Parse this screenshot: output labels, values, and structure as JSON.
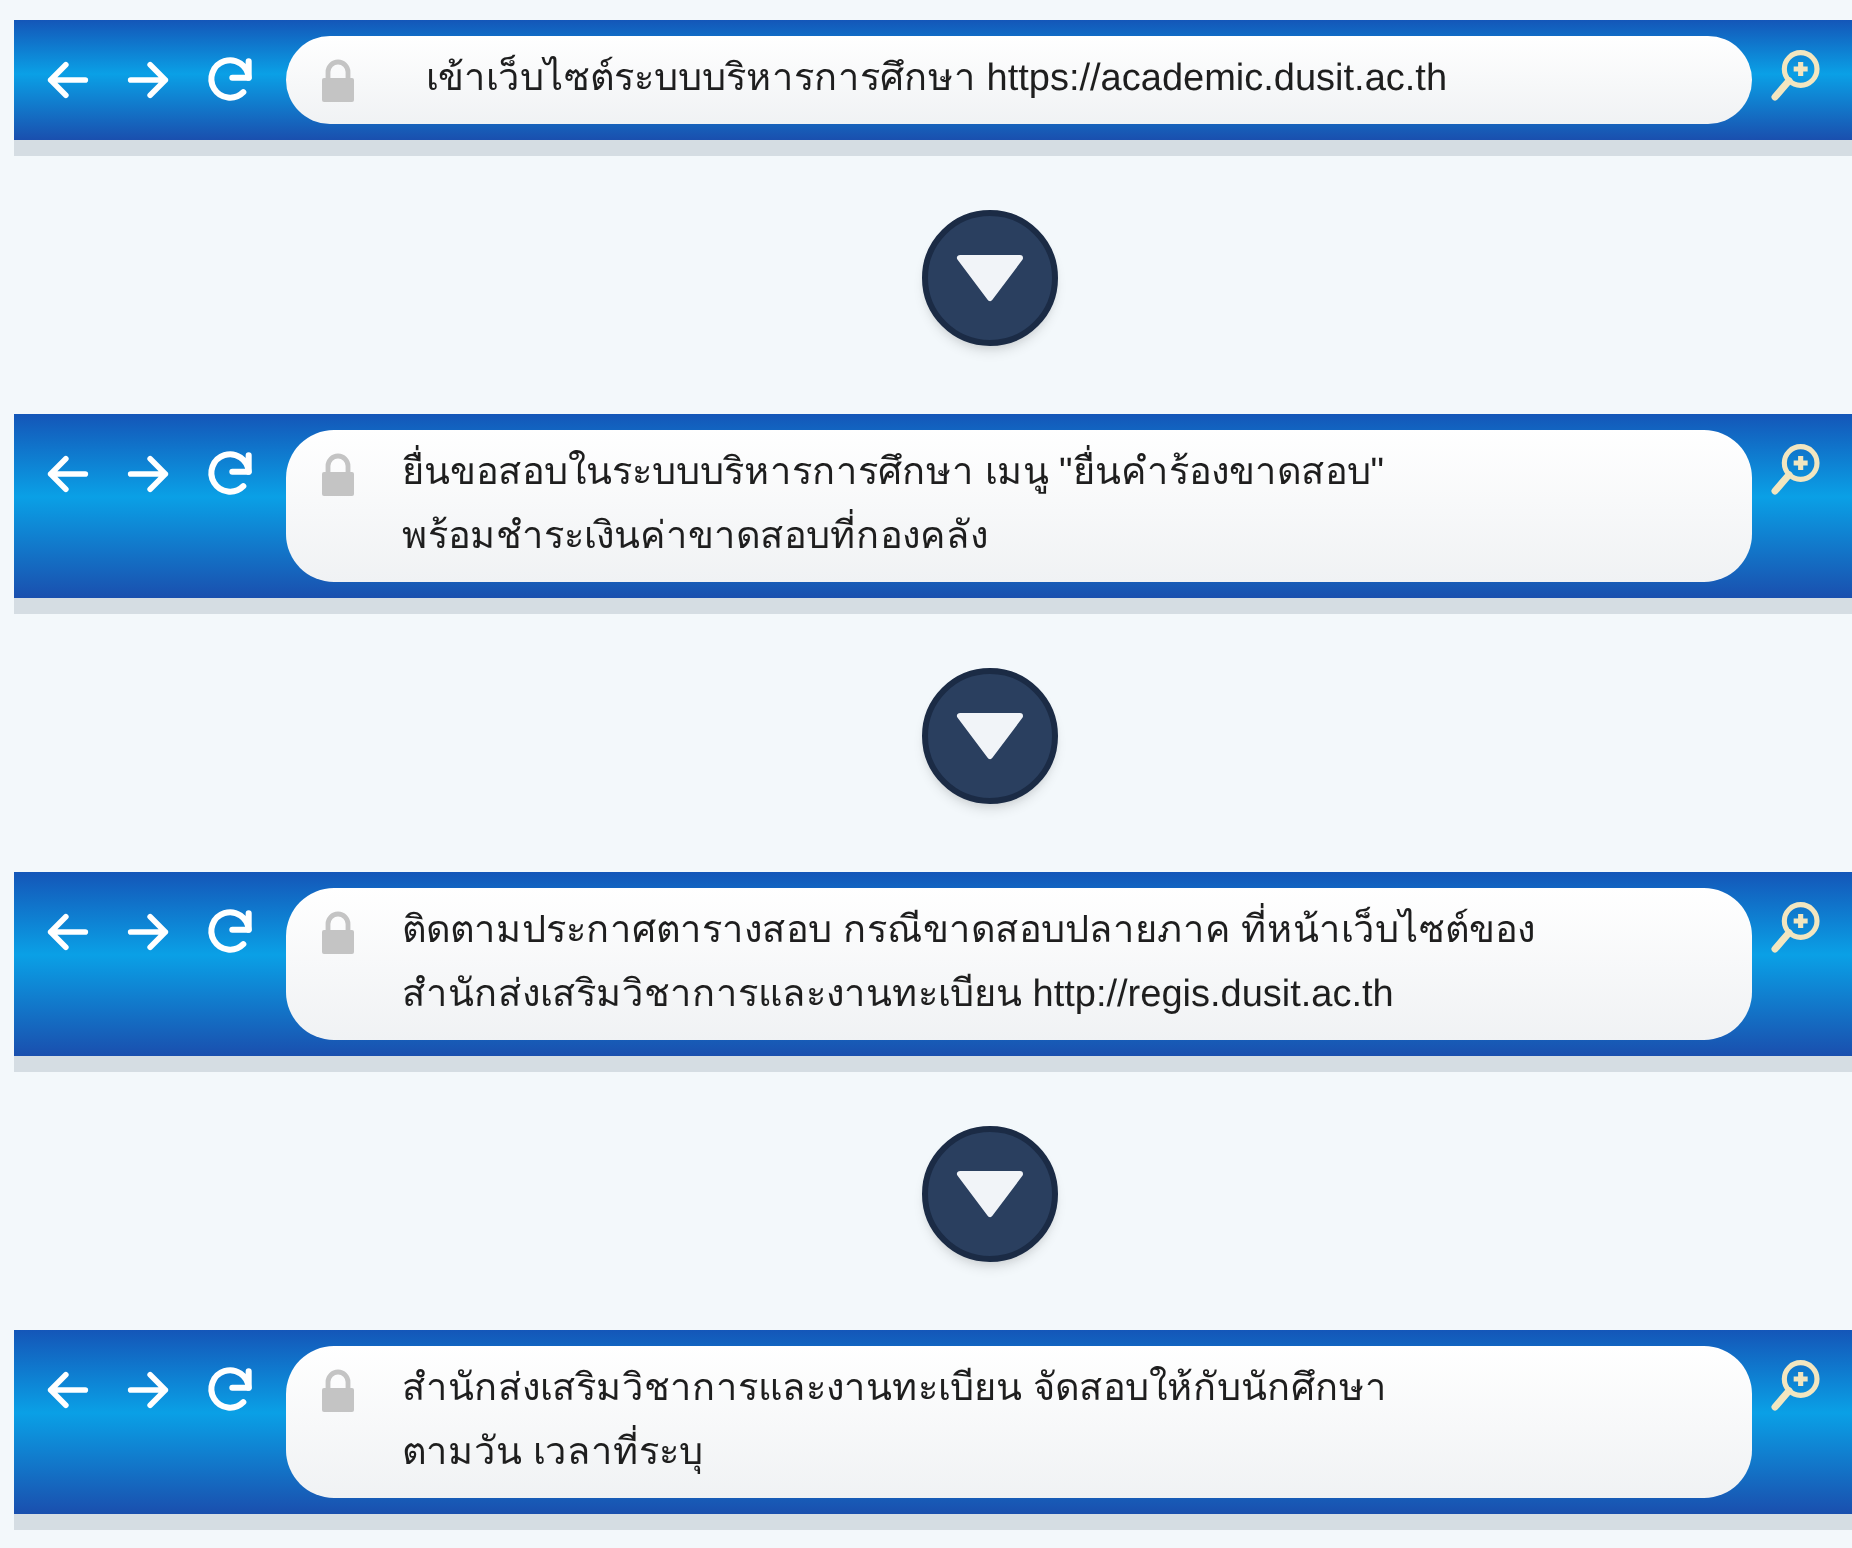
{
  "steps": [
    {
      "lines": [
        "เข้าเว็บไซต์ระบบบริหารการศึกษา https://academic.dusit.ac.th"
      ]
    },
    {
      "lines": [
        "ยื่นขอสอบในระบบบริหารการศึกษา เมนู \"ยื่นคำร้องขาดสอบ\"",
        "พร้อมชำระเงินค่าขาดสอบที่กองคลัง"
      ]
    },
    {
      "lines": [
        "ติดตามประกาศตารางสอบ กรณีขาดสอบปลายภาค ที่หน้าเว็บไซต์ของ",
        "สำนักส่งเสริมวิชาการและงานทะเบียน http://regis.dusit.ac.th"
      ]
    },
    {
      "lines": [
        "สำนักส่งเสริมวิชาการและงานทะเบียน จัดสอบให้กับนักศึกษา",
        "ตามวัน เวลาที่ระบุ"
      ]
    }
  ]
}
